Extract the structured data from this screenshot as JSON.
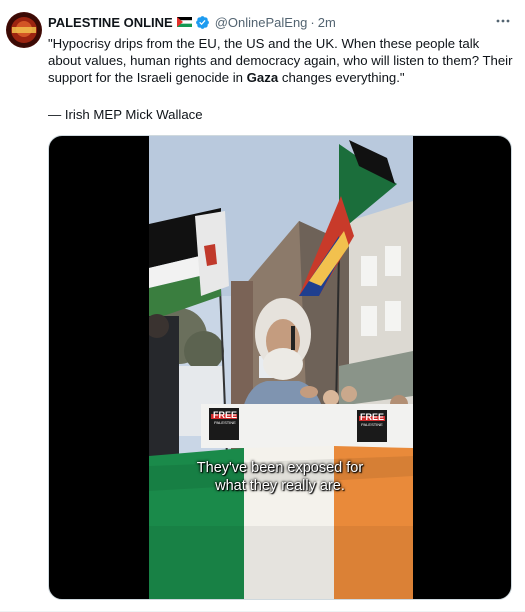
{
  "tweet": {
    "display_name": "PALESTINE ONLINE",
    "handle": "@OnlinePalEng",
    "separator": "·",
    "time": "2m",
    "text_before_gaza": "\"Hypocrisy drips from the EU, the US and the UK. When these people talk about values, human rights and democracy again, who will listen to them? Their support for the Israeli genocide in ",
    "text_gaza": "Gaza",
    "text_after_gaza": " changes everything.\"",
    "attribution": "— Irish MEP Mick Wallace"
  },
  "media": {
    "caption_line1": "They've been exposed for",
    "caption_line2": "what they really are.",
    "sign_text": "FREE",
    "sign_subtext": "PALESTINE"
  },
  "icons": {
    "verified": "verified-badge-icon",
    "more": "more-options-icon",
    "flag": "palestine-flag-icon"
  },
  "colors": {
    "verified_blue": "#1d9bf0",
    "secondary_text": "#536471",
    "primary_text": "#0f1419"
  }
}
